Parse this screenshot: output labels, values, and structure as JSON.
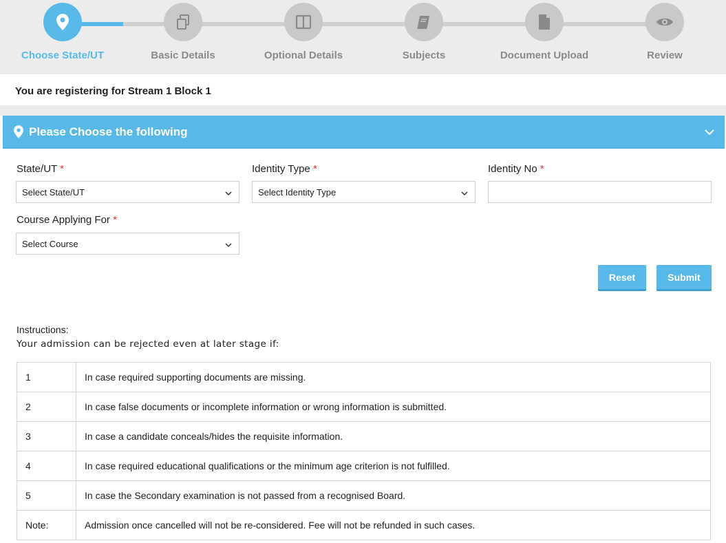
{
  "stepper": {
    "steps": [
      {
        "label": "Choose State/UT",
        "icon": "location-pin-icon",
        "active": true
      },
      {
        "label": "Basic Details",
        "icon": "documents-icon",
        "active": false
      },
      {
        "label": "Optional Details",
        "icon": "columns-icon",
        "active": false
      },
      {
        "label": "Subjects",
        "icon": "book-icon",
        "active": false
      },
      {
        "label": "Document Upload",
        "icon": "file-icon",
        "active": false
      },
      {
        "label": "Review",
        "icon": "eye-icon",
        "active": false
      }
    ]
  },
  "stream": {
    "text": "You are registering for Stream 1 Block 1"
  },
  "panel": {
    "title": "Please Choose the following"
  },
  "form": {
    "state": {
      "label": "State/UT",
      "required": "*",
      "value": "Select State/UT"
    },
    "identity_type": {
      "label": "Identity Type",
      "required": "*",
      "value": "Select Identity Type"
    },
    "identity_no": {
      "label": "Identity No",
      "required": "*",
      "value": ""
    },
    "course": {
      "label": "Course Applying For",
      "required": "*",
      "value": "Select Course"
    }
  },
  "buttons": {
    "reset": "Reset",
    "submit": "Submit"
  },
  "instructions": {
    "title": "Instructions:",
    "subtitle": "Your admission can be rejected even at later stage if:",
    "rows": [
      {
        "num": "1",
        "text": "In case required supporting documents are missing."
      },
      {
        "num": "2",
        "text": "In case false documents or incomplete information or wrong information is submitted."
      },
      {
        "num": "3",
        "text": "In case a candidate conceals/hides the requisite information."
      },
      {
        "num": "4",
        "text": "In case required educational qualifications or the minimum age criterion is not fulfilled."
      },
      {
        "num": "5",
        "text": "In case the Secondary examination is not passed from a recognised Board."
      },
      {
        "num": "Note:",
        "text": "Admission once cancelled will not be re-considered. Fee will not be refunded in such cases."
      }
    ]
  },
  "colors": {
    "accent": "#58b9e9",
    "inactive_step": "#c9c9c9",
    "required": "#e03131"
  }
}
